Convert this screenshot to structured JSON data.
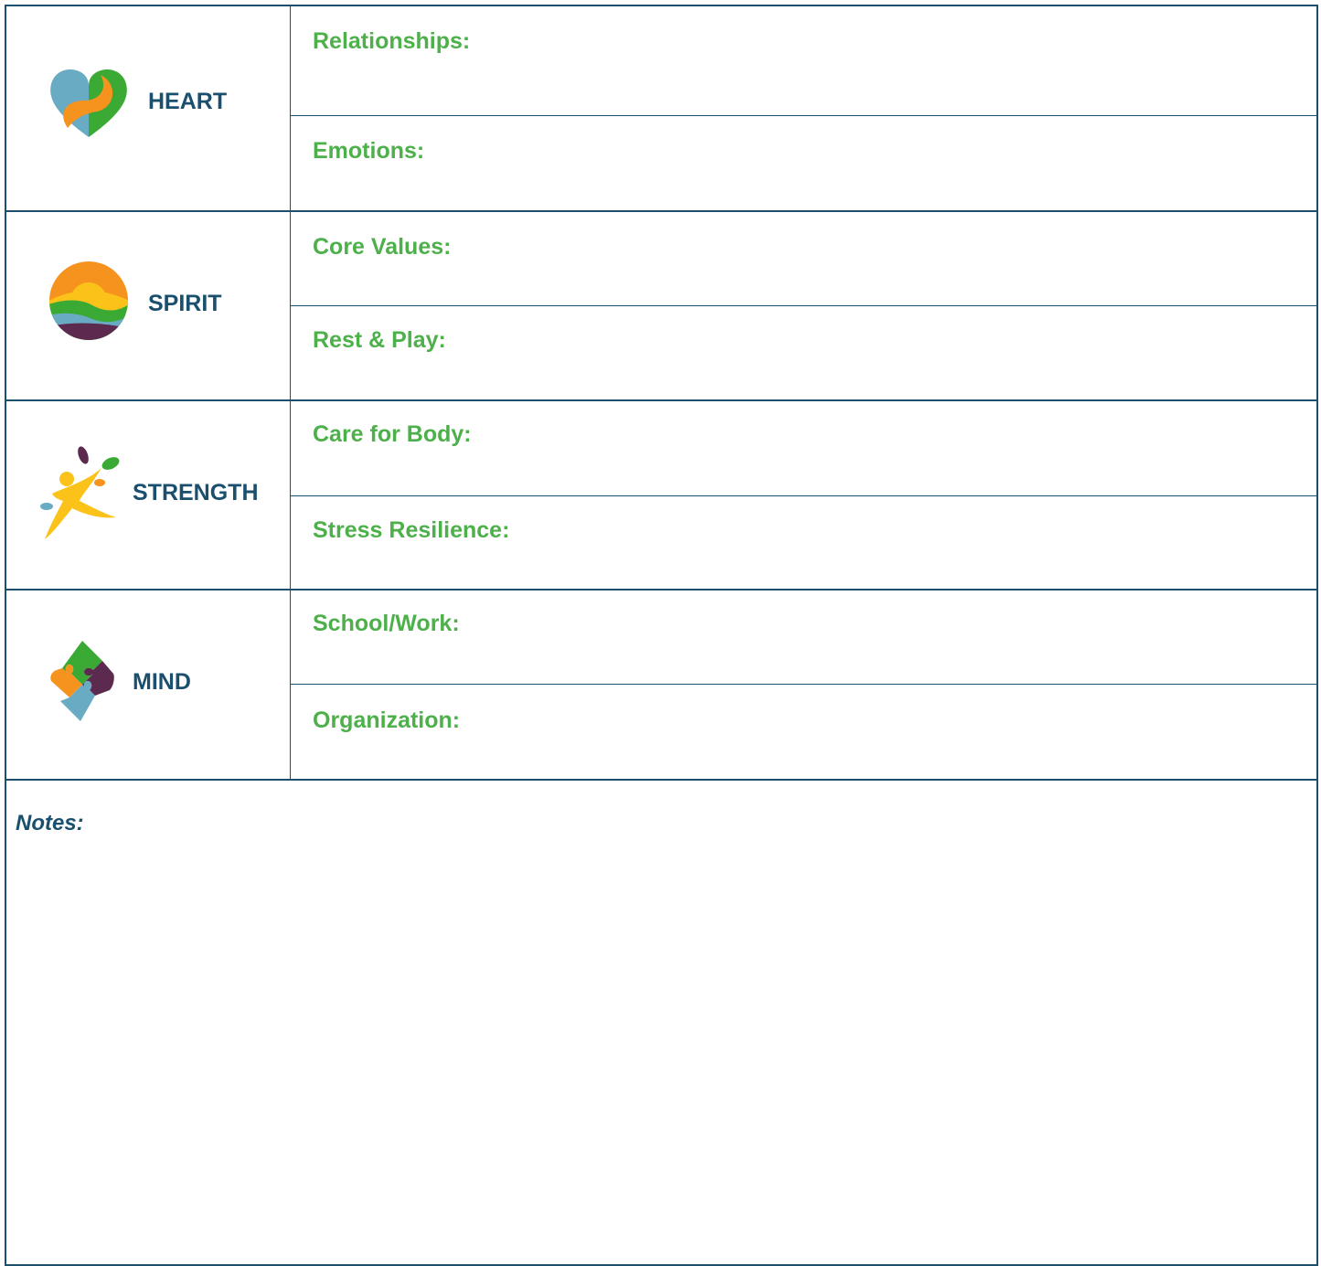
{
  "colors": {
    "border": "#1a4f6e",
    "domain_text": "#1a4f6e",
    "field_text": "#4db04a",
    "orange": "#f6921e",
    "green": "#3aaa35",
    "teal": "#6aabc4",
    "purple": "#5b2a4e",
    "yellow": "#fbc21a"
  },
  "sections": [
    {
      "domain": "HEART",
      "icon": "heart-yinyang-icon",
      "fields": [
        "Relationships:",
        "Emotions:"
      ]
    },
    {
      "domain": "SPIRIT",
      "icon": "sunrise-hills-icon",
      "fields": [
        "Core Values:",
        "Rest & Play:"
      ]
    },
    {
      "domain": "STRENGTH",
      "icon": "leaping-figure-icon",
      "fields": [
        "Care for Body:",
        "Stress Resilience:"
      ]
    },
    {
      "domain": "MIND",
      "icon": "puzzle-pieces-icon",
      "fields": [
        "School/Work:",
        "Organization:"
      ]
    }
  ],
  "notes": {
    "label": "Notes:"
  }
}
